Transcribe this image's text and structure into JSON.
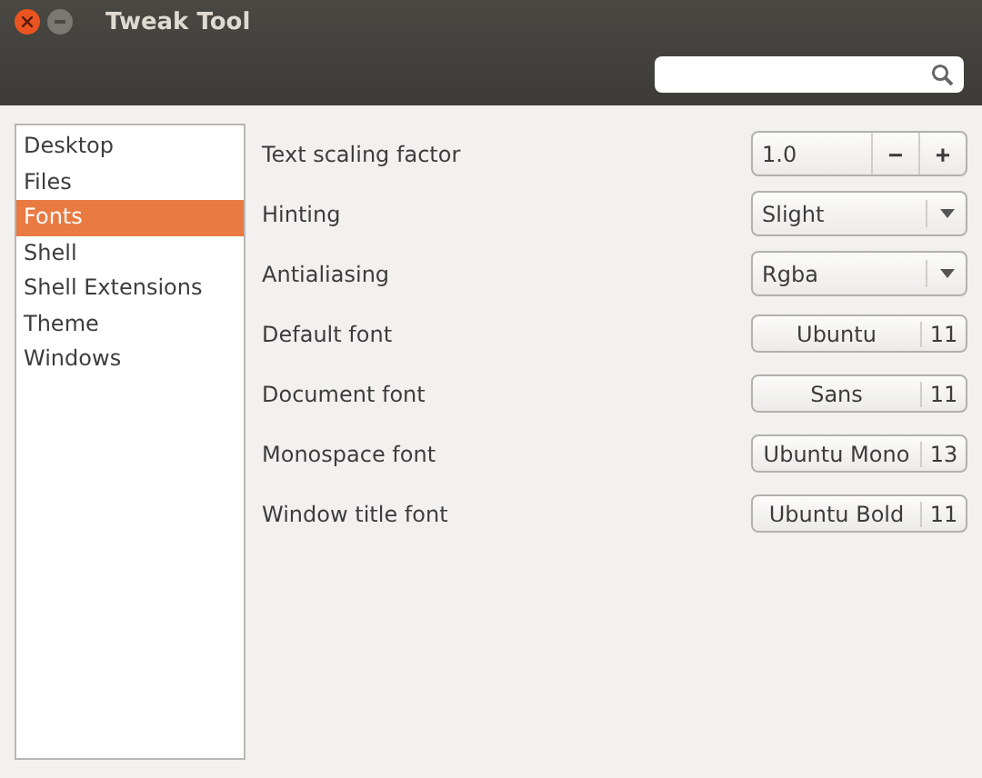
{
  "window": {
    "title": "Tweak Tool"
  },
  "sidebar": {
    "items": [
      {
        "label": "Desktop",
        "selected": false
      },
      {
        "label": "Files",
        "selected": false
      },
      {
        "label": "Fonts",
        "selected": true
      },
      {
        "label": "Shell",
        "selected": false
      },
      {
        "label": "Shell Extensions",
        "selected": false
      },
      {
        "label": "Theme",
        "selected": false
      },
      {
        "label": "Windows",
        "selected": false
      }
    ]
  },
  "settings": [
    {
      "kind": "spin",
      "label": "Text scaling factor",
      "value": "1.0",
      "minus": "−",
      "plus": "+"
    },
    {
      "kind": "combo",
      "label": "Hinting",
      "value": "Slight"
    },
    {
      "kind": "combo",
      "label": "Antialiasing",
      "value": "Rgba"
    },
    {
      "kind": "font",
      "label": "Default font",
      "value": "Ubuntu",
      "size": "11"
    },
    {
      "kind": "font",
      "label": "Document font",
      "value": "Sans",
      "size": "11"
    },
    {
      "kind": "font",
      "label": "Monospace font",
      "value": "Ubuntu Mono",
      "size": "13"
    },
    {
      "kind": "font",
      "label": "Window title font",
      "value": "Ubuntu Bold",
      "size": "11"
    }
  ]
}
